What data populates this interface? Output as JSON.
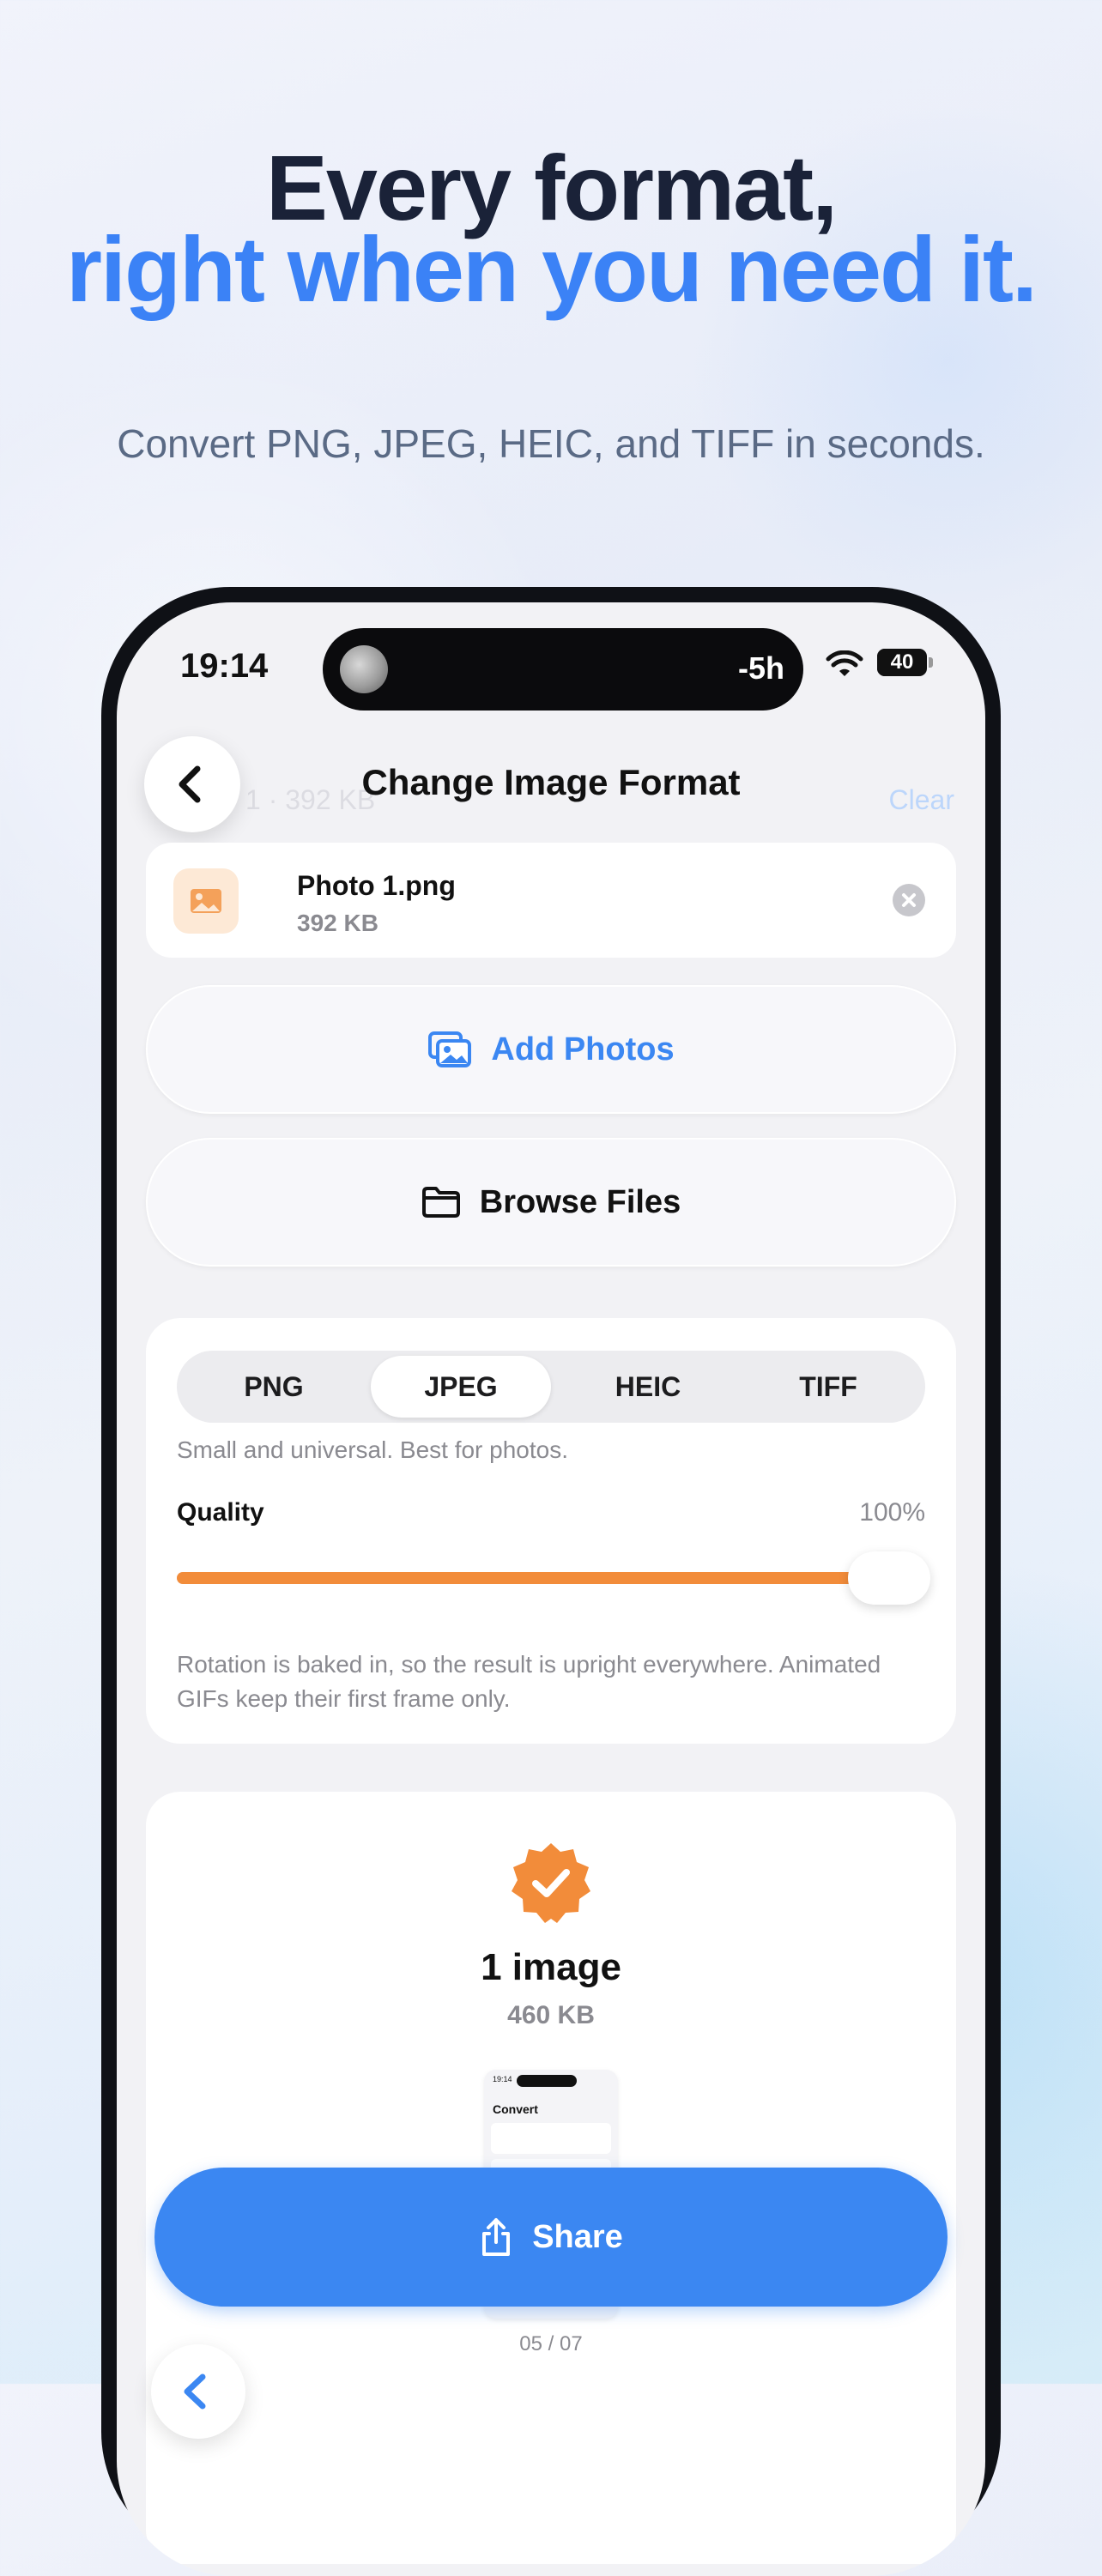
{
  "headline": {
    "line1": "Every format,",
    "line2": "right when you need it.",
    "subtitle": "Convert PNG, JPEG, HEIC, and TIFF in seconds."
  },
  "status_bar": {
    "time": "19:14",
    "island_text": "-5h",
    "battery": "40"
  },
  "nav": {
    "title": "Change Image Format",
    "ghost_left": "1 · 392 KB",
    "ghost_right": "Clear"
  },
  "file": {
    "name": "Photo 1.png",
    "size": "392 KB"
  },
  "actions": {
    "add_photos": "Add Photos",
    "browse_files": "Browse Files"
  },
  "format_picker": {
    "options": [
      "PNG",
      "JPEG",
      "HEIC",
      "TIFF"
    ],
    "selected": "JPEG",
    "description": "Small and universal. Best for photos."
  },
  "quality": {
    "label": "Quality",
    "value_text": "100%",
    "value": 1.0
  },
  "note": "Rotation is baked in, so the result is upright everywhere. Animated GIFs keep their first frame only.",
  "result": {
    "count": "1 image",
    "size": "460 KB",
    "preview_time": "19:14",
    "preview_title": "Convert",
    "page": "05 / 07"
  },
  "share": {
    "label": "Share"
  },
  "colors": {
    "accent": "#3b87f2",
    "slider": "#f28c3a",
    "headline_dark": "#1a2238",
    "headline_blue": "#3b82f6"
  }
}
